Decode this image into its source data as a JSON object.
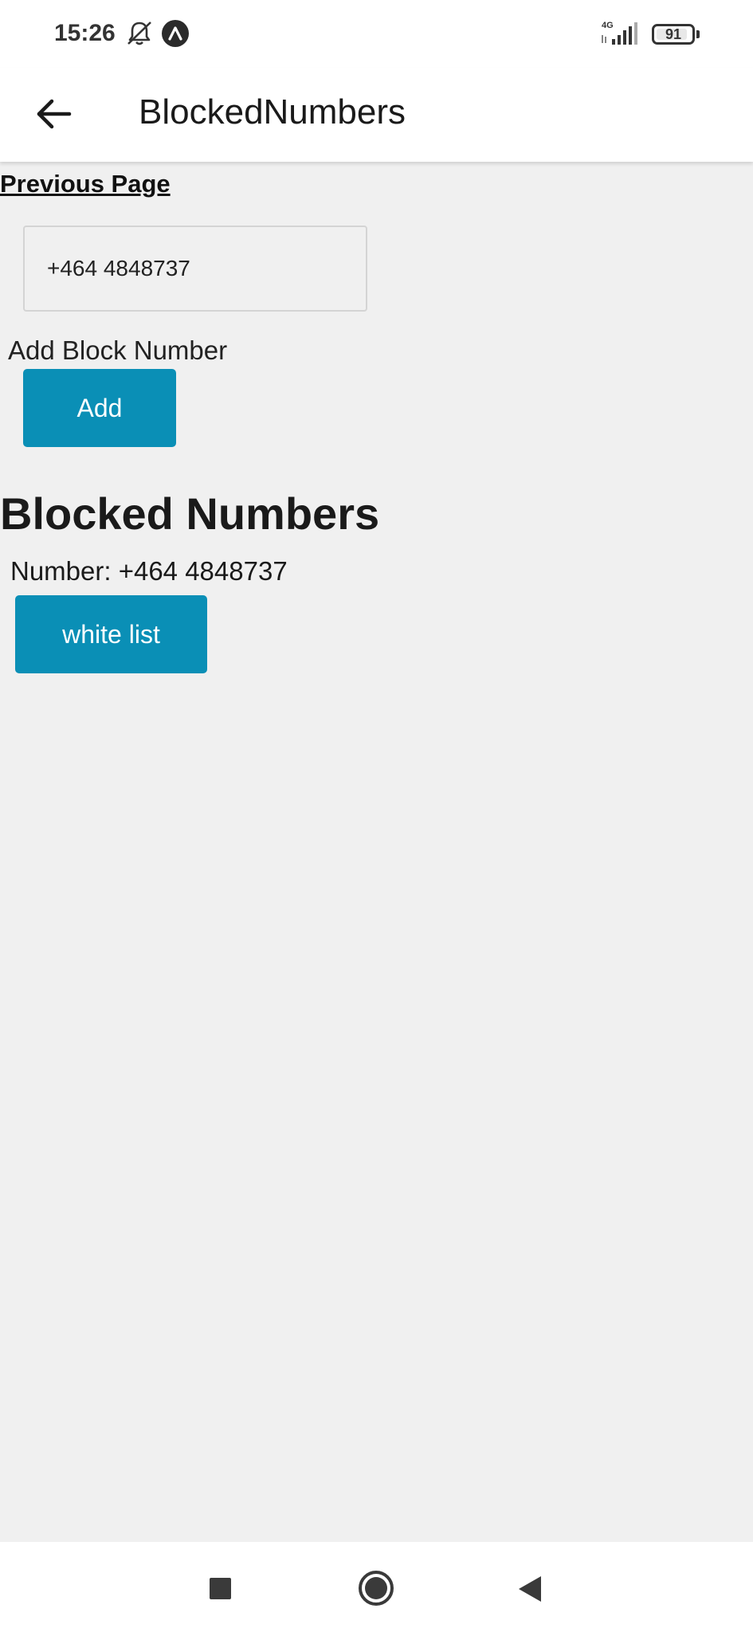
{
  "status_bar": {
    "time": "15:26",
    "network": "4G",
    "battery": "91",
    "battery_level": 0.91,
    "icons": [
      "bell-muted-icon",
      "app-notification-icon",
      "signal-icon",
      "battery-icon"
    ]
  },
  "app_bar": {
    "title": "BlockedNumbers",
    "back_icon": "arrow-left-icon"
  },
  "content": {
    "previous_page_link": "Previous Page",
    "phone_input_value": "+464 4848737",
    "add_label": "Add Block Number",
    "add_button": "Add",
    "section_heading": "Blocked Numbers",
    "blocked_numbers": [
      {
        "label": "Number: +464 4848737",
        "action": "white list"
      }
    ]
  },
  "nav_bar": {
    "icons": [
      "recents-square-icon",
      "home-circle-icon",
      "back-triangle-icon"
    ]
  },
  "colors": {
    "accent": "#0a8fb6",
    "background": "#f0f0f0",
    "bars": "#ffffff"
  }
}
